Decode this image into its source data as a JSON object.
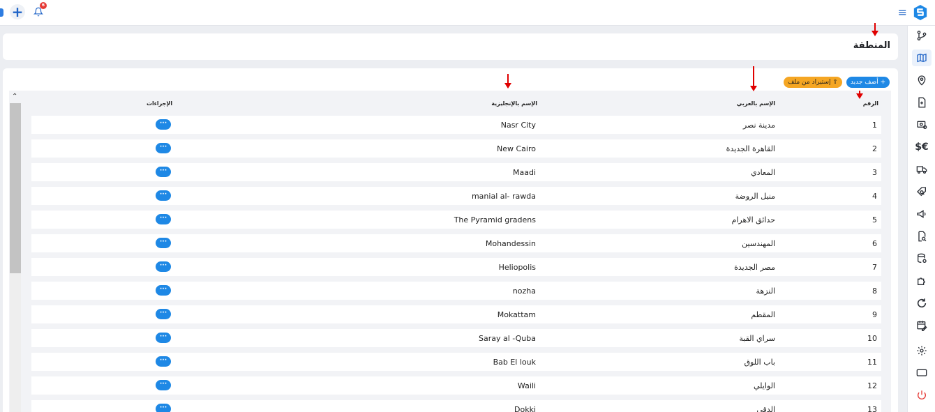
{
  "topbar": {
    "notification_count": "6"
  },
  "sidebar": {
    "items": [
      {
        "icon": "branch-icon"
      },
      {
        "icon": "map-icon",
        "active": true
      },
      {
        "icon": "pin-icon"
      },
      {
        "icon": "document-plus-icon"
      },
      {
        "icon": "finance-settings-icon"
      },
      {
        "icon": "currency-icon",
        "glyph": "$€"
      },
      {
        "icon": "delivery-truck-icon"
      },
      {
        "icon": "tag-search-icon"
      },
      {
        "icon": "megaphone-icon"
      },
      {
        "icon": "document-search-icon"
      },
      {
        "icon": "database-icon"
      },
      {
        "icon": "puzzle-icon"
      },
      {
        "icon": "refresh-icon"
      },
      {
        "icon": "calendar-edit-icon"
      },
      {
        "icon": "gear-icon"
      },
      {
        "icon": "display-icon"
      },
      {
        "icon": "power-icon",
        "color": "#e53935"
      }
    ]
  },
  "page": {
    "title": "المنطقة"
  },
  "toolbar": {
    "add_label": "+ أضف جديد",
    "import_label": "⇪ إستيراد من ملف"
  },
  "table": {
    "headers": {
      "number": "الرقم",
      "arabic_name": "الإسم بالعربي",
      "english_name": "الإسم بالإنجليزية",
      "actions": "الإجراءات"
    },
    "action_label": "···",
    "rows": [
      {
        "num": "1",
        "ar": "مدينة نصر",
        "en": "Nasr City"
      },
      {
        "num": "2",
        "ar": "القاهرة الجديدة",
        "en": "New Cairo"
      },
      {
        "num": "3",
        "ar": "المعادي",
        "en": "Maadi"
      },
      {
        "num": "4",
        "ar": "منيل الروضة",
        "en": "manial al- rawda"
      },
      {
        "num": "5",
        "ar": "حدائق الاهرام",
        "en": "The Pyramid gradens"
      },
      {
        "num": "6",
        "ar": "المهندسين",
        "en": "Mohandessin"
      },
      {
        "num": "7",
        "ar": "مصر الجديدة",
        "en": "Heliopolis"
      },
      {
        "num": "8",
        "ar": "النزهة",
        "en": "nozha"
      },
      {
        "num": "9",
        "ar": "المقطم",
        "en": "Mokattam"
      },
      {
        "num": "10",
        "ar": "سراي القبة",
        "en": "Saray al -Quba"
      },
      {
        "num": "11",
        "ar": "باب اللوق",
        "en": "Bab El louk"
      },
      {
        "num": "12",
        "ar": "الوايلي",
        "en": "Waili"
      },
      {
        "num": "13",
        "ar": "الدقي",
        "en": "Dokki"
      }
    ]
  },
  "colors": {
    "primary": "#1e88e5",
    "import": "#f5a623",
    "annotation_arrow": "#e00000",
    "logout": "#e53935"
  }
}
